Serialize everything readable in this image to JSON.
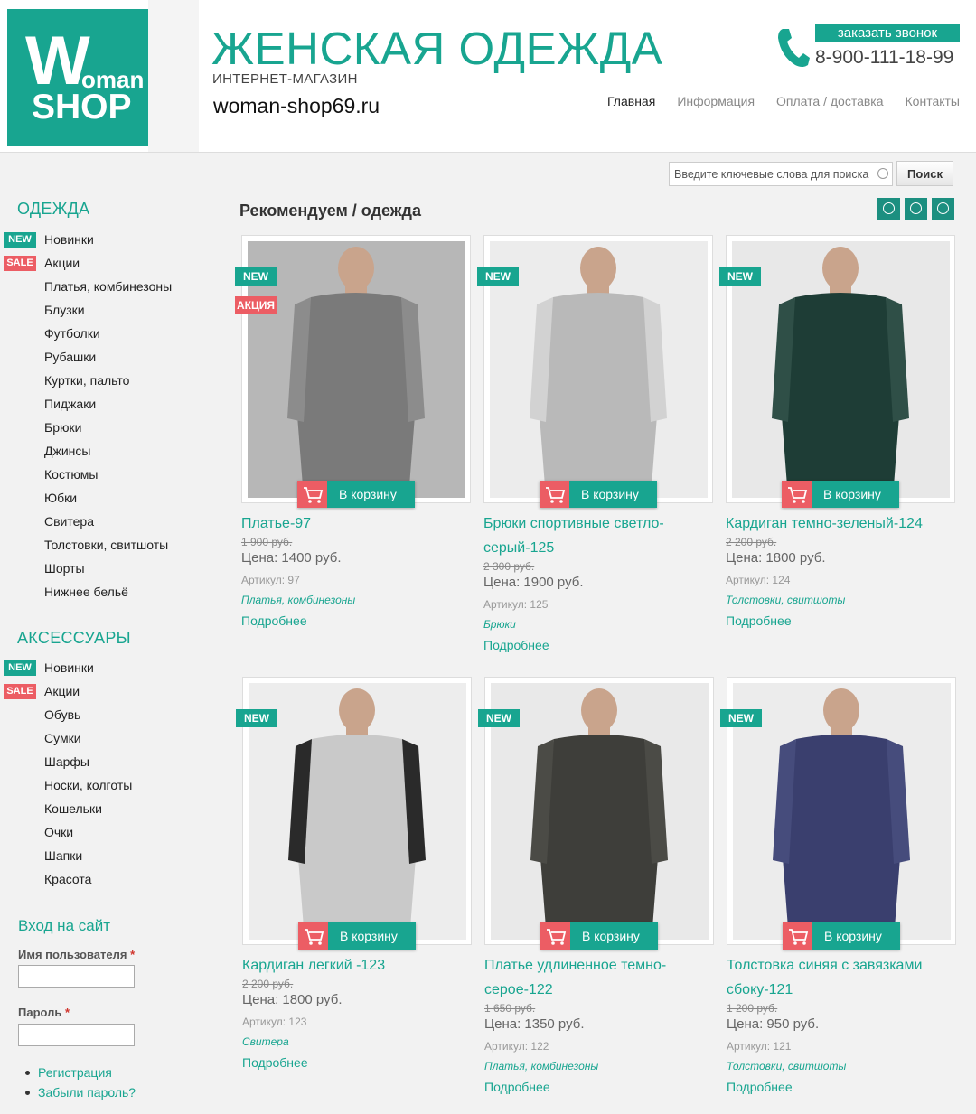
{
  "header": {
    "logo_w": "W",
    "logo_oman": "oman",
    "logo_shop": "SHOP",
    "title": "ЖЕНСКАЯ ОДЕЖДА",
    "subtitle": "ИНТЕРНЕТ-МАГАЗИН",
    "url": "woman-shop69.ru",
    "callback_label": "заказать звонок",
    "phone": "8-900-111-18-99",
    "nav": [
      "Главная",
      "Информация",
      "Оплата / доставка",
      "Контакты"
    ]
  },
  "search": {
    "placeholder": "Введите ключевые слова для поиска",
    "button_label": "Поиск"
  },
  "sidebar": {
    "clothes_title": "ОДЕЖДА",
    "clothes": [
      {
        "label": "Новинки",
        "badge": "NEW"
      },
      {
        "label": "Акции",
        "badge": "SALE"
      },
      {
        "label": "Платья, комбинезоны",
        "badge": ""
      },
      {
        "label": "Блузки",
        "badge": ""
      },
      {
        "label": "Футболки",
        "badge": ""
      },
      {
        "label": "Рубашки",
        "badge": ""
      },
      {
        "label": "Куртки, пальто",
        "badge": ""
      },
      {
        "label": "Пиджаки",
        "badge": ""
      },
      {
        "label": "Брюки",
        "badge": ""
      },
      {
        "label": "Джинсы",
        "badge": ""
      },
      {
        "label": "Костюмы",
        "badge": ""
      },
      {
        "label": "Юбки",
        "badge": ""
      },
      {
        "label": "Свитера",
        "badge": ""
      },
      {
        "label": "Толстовки, свитшоты",
        "badge": ""
      },
      {
        "label": "Шорты",
        "badge": ""
      },
      {
        "label": "Нижнее бельё",
        "badge": ""
      }
    ],
    "accessories_title": "АКСЕССУАРЫ",
    "accessories": [
      {
        "label": "Новинки",
        "badge": "NEW"
      },
      {
        "label": "Акции",
        "badge": "SALE"
      },
      {
        "label": "Обувь",
        "badge": ""
      },
      {
        "label": "Сумки",
        "badge": ""
      },
      {
        "label": "Шарфы",
        "badge": ""
      },
      {
        "label": "Носки, колготы",
        "badge": ""
      },
      {
        "label": "Кошельки",
        "badge": ""
      },
      {
        "label": "Очки",
        "badge": ""
      },
      {
        "label": "Шапки",
        "badge": ""
      },
      {
        "label": "Красота",
        "badge": ""
      }
    ]
  },
  "login": {
    "title": "Вход на сайт",
    "username_label": "Имя пользователя",
    "password_label": "Пароль",
    "required_mark": "*",
    "links": [
      "Регистрация",
      "Забыли пароль?"
    ]
  },
  "main": {
    "heading": "Рекомендуем / одежда",
    "cart_label": "В корзину",
    "more_label": "Подробнее",
    "products": [
      {
        "name": "Платье-97",
        "old_price": "1 900 руб.",
        "price": "Цена: 1400 руб.",
        "sku": "Артикул: 97",
        "category": "Платья, комбинезоны",
        "badges": [
          "NEW",
          "АКЦИЯ"
        ],
        "colors": [
          "#7a7a7a",
          "#8c8c8c",
          "#b7b7b7"
        ]
      },
      {
        "name": "Брюки спортивные светло-серый-125",
        "old_price": "2 300 руб.",
        "price": "Цена: 1900 руб.",
        "sku": "Артикул: 125",
        "category": "Брюки",
        "badges": [
          "NEW"
        ],
        "colors": [
          "#b9b9b9",
          "#d2d2d2",
          "#ececec"
        ]
      },
      {
        "name": "Кардиган темно-зеленый-124",
        "old_price": "2 200 руб.",
        "price": "Цена: 1800 руб.",
        "sku": "Артикул: 124",
        "category": "Толстовки, свитшоты",
        "badges": [
          "NEW"
        ],
        "colors": [
          "#1e3d36",
          "#2f4f47",
          "#e8e8e8"
        ]
      },
      {
        "name": "Кардиган легкий -123",
        "old_price": "2 200 руб.",
        "price": "Цена: 1800 руб.",
        "sku": "Артикул: 123",
        "category": "Свитера",
        "badges": [
          "NEW"
        ],
        "colors": [
          "#c9c9c9",
          "#2a2a2a",
          "#ededed"
        ]
      },
      {
        "name": "Платье удлиненное темно-серое-122",
        "old_price": "1 650 руб.",
        "price": "Цена: 1350 руб.",
        "sku": "Артикул: 122",
        "category": "Платья, комбинезоны",
        "badges": [
          "NEW"
        ],
        "colors": [
          "#3e3e3a",
          "#4b4b46",
          "#e9e9e9"
        ]
      },
      {
        "name": "Толстовка синяя с завязками сбоку-121",
        "old_price": "1 200 руб.",
        "price": "Цена: 950 руб.",
        "sku": "Артикул: 121",
        "category": "Толстовки, свитшоты",
        "badges": [
          "NEW"
        ],
        "colors": [
          "#3a3f6e",
          "#464c7c",
          "#ececec"
        ]
      }
    ]
  },
  "colors": {
    "accent": "#18a590",
    "sale": "#ec5d64",
    "badge_dark": "#1c8f80"
  }
}
